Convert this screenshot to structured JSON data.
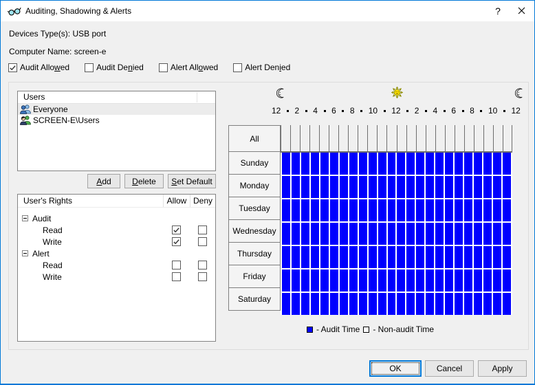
{
  "colors": {
    "accent": "#0078d7",
    "audit_blue": "#0000ff",
    "dialog_bg": "#f0f0f0",
    "titlebar_bg": "#ffffff",
    "selection_bg": "#ececec",
    "grid_line": "#6d6d6d"
  },
  "titlebar": {
    "icon": "eyeglasses-icon",
    "title": "Auditing, Shadowing & Alerts",
    "help_label": "?"
  },
  "info": {
    "devices_type": "Devices Type(s): USB port",
    "computer_name": "Computer Name: screen-e"
  },
  "filter_checkboxes": [
    {
      "pre": "Audit Allo",
      "key": "w",
      "post": "ed",
      "checked": true
    },
    {
      "pre": "Audit De",
      "key": "n",
      "post": "ied",
      "checked": false
    },
    {
      "pre": "Alert All",
      "key": "o",
      "post": "wed",
      "checked": false
    },
    {
      "pre": "Alert Den",
      "key": "i",
      "post": "ed",
      "checked": false
    }
  ],
  "users_panel": {
    "header": "Users",
    "items": [
      {
        "name": "Everyone",
        "icon": "everyone-group-icon",
        "selected": true
      },
      {
        "name": "SCREEN-E\\Users",
        "icon": "local-users-group-icon",
        "selected": false
      }
    ],
    "buttons": [
      {
        "pre": "",
        "key": "A",
        "post": "dd",
        "name": "add-button"
      },
      {
        "pre": "",
        "key": "D",
        "post": "elete",
        "name": "delete-button"
      },
      {
        "pre": "",
        "key": "S",
        "post": "et Default",
        "name": "set-default-button"
      }
    ]
  },
  "rights_table": {
    "headers": [
      "User's Rights",
      "Allow",
      "Deny"
    ],
    "groups": [
      {
        "label": "Audit",
        "expanded": true,
        "children": [
          {
            "label": "Read",
            "allow": true,
            "deny": false
          },
          {
            "label": "Write",
            "allow": true,
            "deny": false
          }
        ]
      },
      {
        "label": "Alert",
        "expanded": true,
        "children": [
          {
            "label": "Read",
            "allow": false,
            "deny": false
          },
          {
            "label": "Write",
            "allow": false,
            "deny": false
          }
        ]
      }
    ]
  },
  "time_grid": {
    "header_icons": [
      "moon-icon",
      "sun-icon",
      "moon-icon"
    ],
    "hour_labels": [
      "12",
      "2",
      "4",
      "6",
      "8",
      "10",
      "12",
      "2",
      "4",
      "6",
      "8",
      "10",
      "12"
    ],
    "all_row_label": "All",
    "day_rows": [
      "Sunday",
      "Monday",
      "Tuesday",
      "Wednesday",
      "Thursday",
      "Friday",
      "Saturday"
    ],
    "columns": 24,
    "audit_cells": "all",
    "legend": [
      {
        "swatch_color": "#0000ff",
        "label": "- Audit Time"
      },
      {
        "swatch_color": "#ffffff",
        "label": "- Non-audit Time"
      }
    ]
  },
  "footer_buttons": [
    {
      "label": "OK",
      "name": "ok-button",
      "default": true
    },
    {
      "label": "Cancel",
      "name": "cancel-button",
      "default": false
    },
    {
      "label": "Apply",
      "name": "apply-button",
      "default": false
    }
  ]
}
